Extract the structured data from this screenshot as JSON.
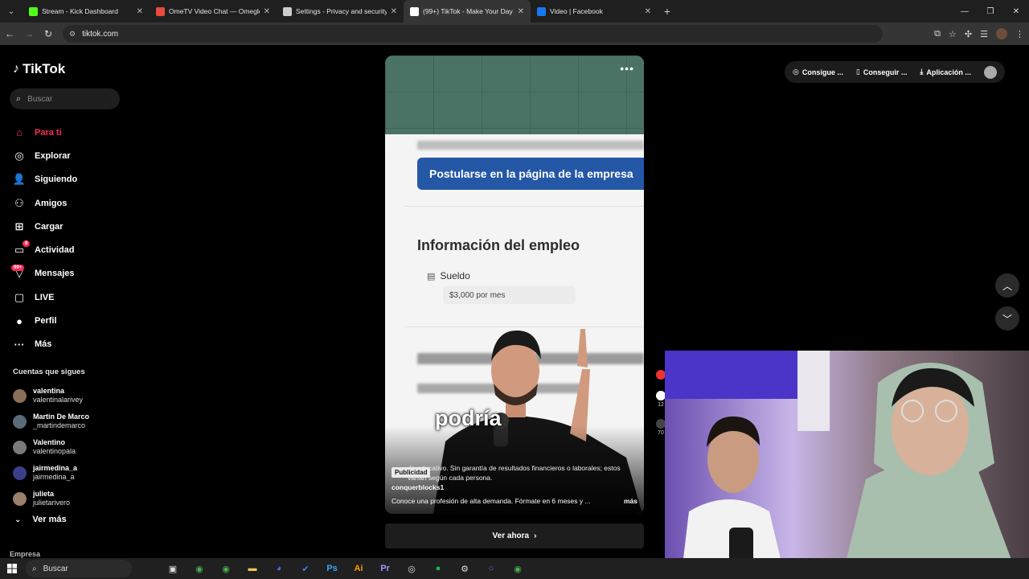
{
  "browser": {
    "tabs": [
      {
        "title": "Stream - Kick Dashboard",
        "icon": "kick-icon",
        "color": "#53fc18"
      },
      {
        "title": "OmeTV Video Chat — Omegle",
        "icon": "ometv-icon",
        "color": "#e94b3c"
      },
      {
        "title": "Settings - Privacy and security",
        "icon": "gear-icon",
        "color": "#cccccc"
      },
      {
        "title": "(99+) TikTok - Make Your Day",
        "icon": "tiktok-icon",
        "color": "#ffffff"
      },
      {
        "title": "Video | Facebook",
        "icon": "facebook-icon",
        "color": "#1877f2"
      }
    ],
    "active_tab": 3,
    "url": "tiktok.com"
  },
  "sidebar": {
    "logo": "TikTok",
    "search_placeholder": "Buscar",
    "nav": [
      {
        "label": "Para ti",
        "icon": "home-icon",
        "active": true
      },
      {
        "label": "Explorar",
        "icon": "compass-icon"
      },
      {
        "label": "Siguiendo",
        "icon": "following-icon"
      },
      {
        "label": "Amigos",
        "icon": "friends-icon"
      },
      {
        "label": "Cargar",
        "icon": "upload-icon"
      },
      {
        "label": "Actividad",
        "icon": "activity-icon",
        "badge": "8"
      },
      {
        "label": "Mensajes",
        "icon": "messages-icon",
        "badge": "99+"
      },
      {
        "label": "LIVE",
        "icon": "live-icon"
      },
      {
        "label": "Perfil",
        "icon": "profile-icon"
      },
      {
        "label": "Más",
        "icon": "more-icon"
      }
    ],
    "following_title": "Cuentas que sigues",
    "following": [
      {
        "name": "valentina",
        "handle": "valentinalarivey"
      },
      {
        "name": "Martin De Marco",
        "handle": "_martindemarco"
      },
      {
        "name": "Valentino",
        "handle": "valentinopala"
      },
      {
        "name": "jairmedina_a",
        "handle": "jairmedina_a"
      },
      {
        "name": "julieta",
        "handle": "julietarivero"
      }
    ],
    "see_more": "Ver más",
    "company": "Empresa"
  },
  "video": {
    "apply_button": "Postularse en la página de la empresa",
    "section_title": "Información del empleo",
    "salary_label": "Sueldo",
    "salary_value": "$3,000 por mes",
    "overlay_word": "podría",
    "ad_badge": "Publicidad",
    "disclaimer": "do educativo. Sin garantía de resultados financieros o laborales; estos varían según cada persona.",
    "author": "conquerblocks1",
    "caption": "Conoce una profesión de alta demanda. Fórmate en 6 meses y ...",
    "caption_more": "más",
    "cta": "Ver ahora"
  },
  "top_actions": {
    "coins": "Consigue ...",
    "get": "Conseguir ...",
    "app": "Aplicación ..."
  },
  "side_actions": {
    "likes": "12",
    "shares": "70"
  },
  "taskbar": {
    "search": "Buscar",
    "apps": [
      {
        "name": "task-view-icon",
        "glyph": "▣",
        "color": "#dddddd"
      },
      {
        "name": "chrome-icon",
        "glyph": "◉",
        "color": "#4caf50"
      },
      {
        "name": "chrome-icon-2",
        "glyph": "◉",
        "color": "#4caf50"
      },
      {
        "name": "folder-icon",
        "glyph": "▬",
        "color": "#f2c14e"
      },
      {
        "name": "discord-icon",
        "glyph": "◕",
        "color": "#5865f2"
      },
      {
        "name": "check-icon",
        "glyph": "✔",
        "color": "#3b82f6"
      },
      {
        "name": "photoshop-icon",
        "glyph": "Ps",
        "color": "#31a8ff"
      },
      {
        "name": "illustrator-icon",
        "glyph": "Ai",
        "color": "#ff9a00"
      },
      {
        "name": "premiere-icon",
        "glyph": "Pr",
        "color": "#9999ff"
      },
      {
        "name": "obs-icon",
        "glyph": "◎",
        "color": "#dddddd"
      },
      {
        "name": "spotify-icon",
        "glyph": "●",
        "color": "#1db954"
      },
      {
        "name": "settings-icon",
        "glyph": "⚙",
        "color": "#dddddd"
      },
      {
        "name": "cortana-icon",
        "glyph": "○",
        "color": "#8b5cf6"
      },
      {
        "name": "chrome-icon-3",
        "glyph": "◉",
        "color": "#4caf50"
      }
    ]
  }
}
